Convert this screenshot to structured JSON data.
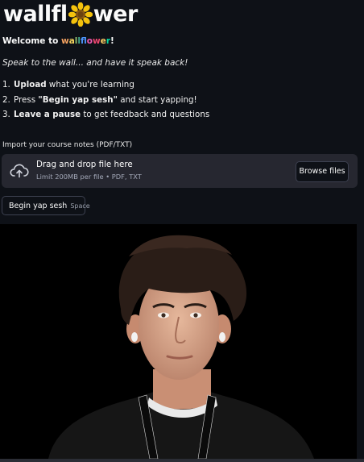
{
  "app": {
    "title_prefix": "wallfl",
    "title_suffix": "wer",
    "title_flower_icon": "sunflower-icon"
  },
  "welcome": {
    "prefix": "Welcome to ",
    "brand": "wallflower",
    "suffix": "!",
    "brand_colors": [
      "#f4a261",
      "#f4d35e",
      "#90be6d",
      "#43aa8b",
      "#4d96ff",
      "#9b5de5",
      "#f15bb5",
      "#ef476f",
      "#ffd166",
      "#06d6a0"
    ]
  },
  "tagline": "Speak to the wall... and have it speak back!",
  "steps": [
    {
      "num": "1.",
      "bold": "Upload",
      "rest": " what you're learning"
    },
    {
      "num": "2.",
      "pre": "Press ",
      "bold": "\"Begin yap sesh\"",
      "rest": " and start yapping!"
    },
    {
      "num": "3.",
      "bold": "Leave a pause",
      "rest": " to get feedback and questions"
    }
  ],
  "upload": {
    "label": "Import your course notes (PDF/TXT)",
    "drop_title": "Drag and drop file here",
    "limit": "Limit 200MB per file • PDF, TXT",
    "browse_label": "Browse files",
    "icon": "cloud-upload-icon"
  },
  "begin_button": {
    "label": "Begin yap sesh",
    "shortcut": "Space"
  },
  "video": {
    "description_icon": "webcam-feed"
  },
  "colors": {
    "background": "#0e1117",
    "surface": "#262730",
    "text": "#fafafa",
    "muted": "#a3a8b8"
  }
}
